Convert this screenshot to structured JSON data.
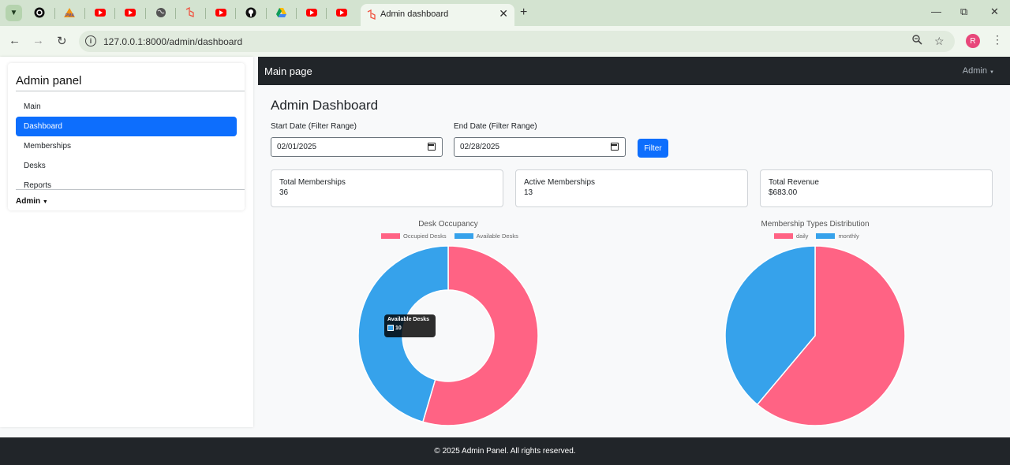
{
  "browser": {
    "tab_title": "Admin dashboard",
    "url": "127.0.0.1:8000/admin/dashboard",
    "profile_initial": "R",
    "pinned_icons": [
      "threads-icon",
      "pma-icon",
      "youtube-icon",
      "youtube-icon",
      "globe-icon",
      "laravel-icon",
      "youtube-icon",
      "github-icon",
      "google-drive-icon",
      "youtube-icon",
      "youtube-icon"
    ]
  },
  "sidebar": {
    "title": "Admin panel",
    "items": [
      {
        "label": "Main",
        "active": false
      },
      {
        "label": "Dashboard",
        "active": true
      },
      {
        "label": "Memberships",
        "active": false
      },
      {
        "label": "Desks",
        "active": false
      },
      {
        "label": "Reports",
        "active": false
      }
    ],
    "admin_label": "Admin"
  },
  "topbar": {
    "brand": "Main page",
    "user_label": "Admin"
  },
  "main": {
    "title": "Admin Dashboard",
    "start_label": "Start Date (Filter Range)",
    "start_value": "02/01/2025",
    "end_label": "End Date (Filter Range)",
    "end_value": "02/28/2025",
    "filter_label": "Filter"
  },
  "stats": [
    {
      "label": "Total Memberships",
      "value": "36"
    },
    {
      "label": "Active Memberships",
      "value": "13"
    },
    {
      "label": "Total Revenue",
      "value": "$683.00"
    }
  ],
  "colors": {
    "pink": "#ff6384",
    "blue": "#36a2eb",
    "accent": "#0d6efd",
    "dark": "#212529"
  },
  "chart_data": [
    {
      "type": "doughnut",
      "title": "Desk Occupancy",
      "categories": [
        "Occupied Desks",
        "Available Desks"
      ],
      "values": [
        12,
        10
      ],
      "colors": [
        "#ff6384",
        "#36a2eb"
      ],
      "legend": "top",
      "tooltip": {
        "title": "Available Desks",
        "value": "10"
      }
    },
    {
      "type": "pie",
      "title": "Membership Types Distribution",
      "categories": [
        "daily",
        "monthly"
      ],
      "values": [
        22,
        14
      ],
      "colors": [
        "#ff6384",
        "#36a2eb"
      ],
      "legend": "top"
    }
  ],
  "footer": {
    "text": "© 2025 Admin Panel. All rights reserved."
  }
}
